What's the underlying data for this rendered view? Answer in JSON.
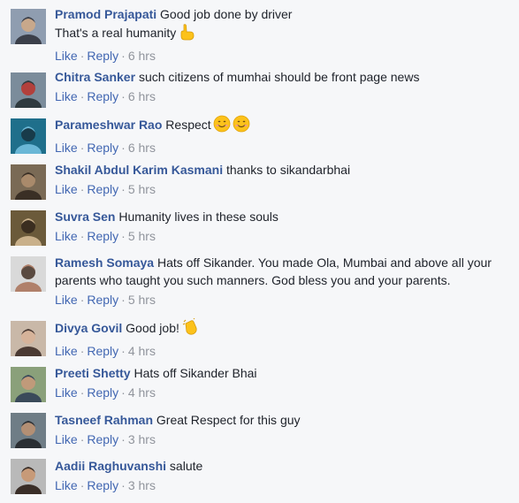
{
  "comments": [
    {
      "author": "Pramod Prajapati",
      "text": "Good job done by driver\nThat's a real humanity",
      "emoji": "point-hand-icon",
      "like": "Like",
      "reply": "Reply",
      "time": "6 hrs",
      "avatar_colors": [
        "#8f9db0",
        "#3b3f4a",
        "#c8a88b"
      ]
    },
    {
      "author": "Chitra Sanker",
      "text": "such citizens of mumhai should be front page news",
      "emoji": "",
      "like": "Like",
      "reply": "Reply",
      "time": "6 hrs",
      "avatar_colors": [
        "#7b8c9b",
        "#2f3a3f",
        "#b2403c"
      ]
    },
    {
      "author": "Parameshwar Rao",
      "text": "Respect",
      "emoji": "smile-icons",
      "like": "Like",
      "reply": "Reply",
      "time": "6 hrs",
      "avatar_colors": [
        "#1f6f8b",
        "#6ab7d6",
        "#183b4a"
      ]
    },
    {
      "author": "Shakil Abdul Karim Kasmani",
      "text": "thanks to sikandarbhai",
      "emoji": "",
      "like": "Like",
      "reply": "Reply",
      "time": "5 hrs",
      "avatar_colors": [
        "#7a6a55",
        "#3a2f25",
        "#a98a6b"
      ]
    },
    {
      "author": "Suvra Sen",
      "text": "Humanity lives in these souls",
      "emoji": "",
      "like": "Like",
      "reply": "Reply",
      "time": "5 hrs",
      "avatar_colors": [
        "#6b5a3a",
        "#c9b08a",
        "#3b2e20"
      ]
    },
    {
      "author": "Ramesh Somaya",
      "text": "Hats off Sikander. You made Ola, Mumbai and above all your parents who taught you such manners. God bless you and your parents.",
      "emoji": "",
      "like": "Like",
      "reply": "Reply",
      "time": "5 hrs",
      "avatar_colors": [
        "#d9d9d9",
        "#b0806a",
        "#5a4a40"
      ]
    },
    {
      "author": "Divya Govil",
      "text": "Good job!",
      "emoji": "clap-icon",
      "like": "Like",
      "reply": "Reply",
      "time": "4 hrs",
      "avatar_colors": [
        "#c9b8a8",
        "#4b3a33",
        "#d6b39a"
      ]
    },
    {
      "author": "Preeti Shetty",
      "text": "Hats off Sikander Bhai",
      "emoji": "",
      "like": "Like",
      "reply": "Reply",
      "time": "4 hrs",
      "avatar_colors": [
        "#8aa07a",
        "#3a4a5a",
        "#c09a7a"
      ]
    },
    {
      "author": "Tasneef Rahman",
      "text": "Great Respect for this guy",
      "emoji": "",
      "like": "Like",
      "reply": "Reply",
      "time": "3 hrs",
      "avatar_colors": [
        "#6f7d86",
        "#2b2f33",
        "#b38f74"
      ]
    },
    {
      "author": "Aadii Raghuvanshi",
      "text": "salute",
      "emoji": "",
      "like": "Like",
      "reply": "Reply",
      "time": "3 hrs",
      "avatar_colors": [
        "#b9b9b9",
        "#3a2e28",
        "#c79a78"
      ]
    }
  ]
}
